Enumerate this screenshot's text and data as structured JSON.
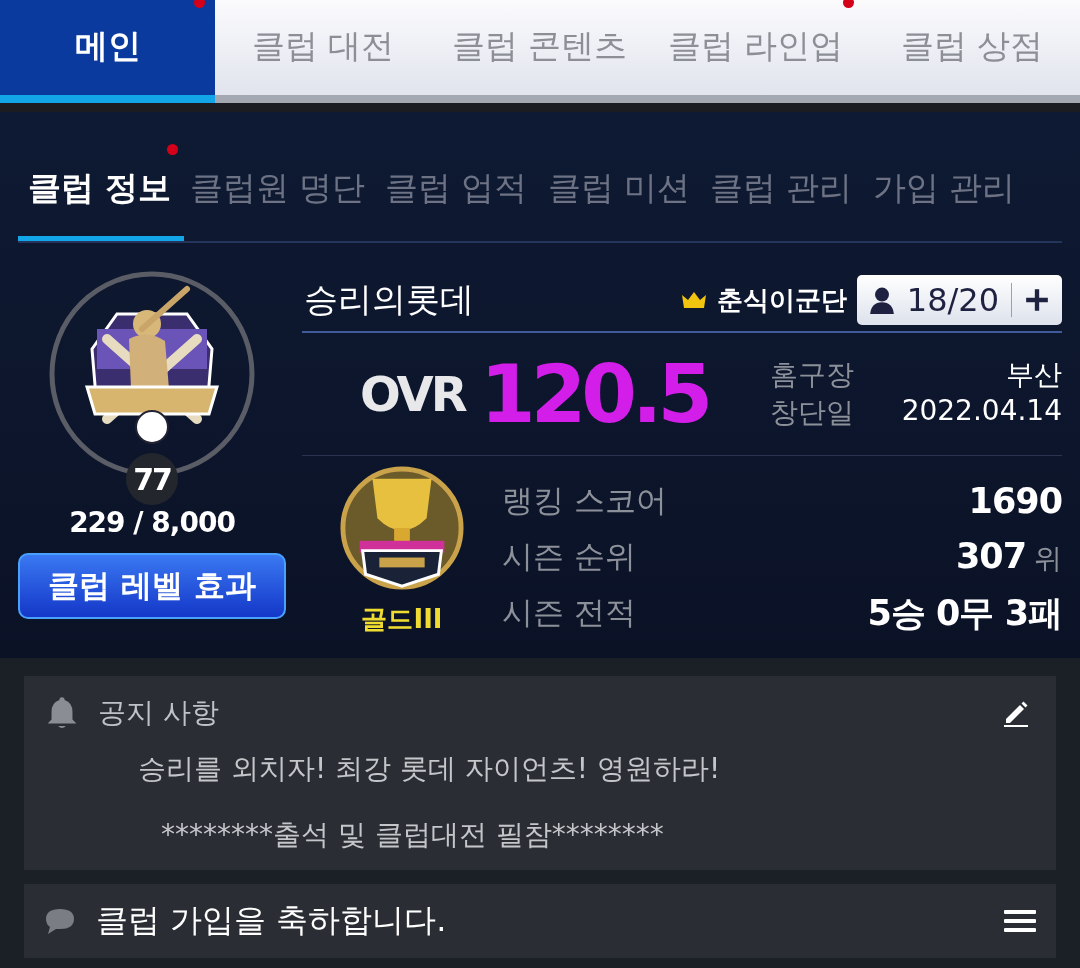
{
  "top_tabs": [
    {
      "label": "메인",
      "selected": true,
      "dot": true
    },
    {
      "label": "클럽 대전",
      "selected": false,
      "dot": false
    },
    {
      "label": "클럽 콘텐츠",
      "selected": false,
      "dot": false
    },
    {
      "label": "클럽 라인업",
      "selected": false,
      "dot": true
    },
    {
      "label": "클럽 상점",
      "selected": false,
      "dot": false
    }
  ],
  "sub_tabs": [
    {
      "label": "클럽 정보",
      "selected": true,
      "dot": true
    },
    {
      "label": "클럽원 명단",
      "selected": false,
      "dot": false
    },
    {
      "label": "클럽 업적",
      "selected": false,
      "dot": false
    },
    {
      "label": "클럽 미션",
      "selected": false,
      "dot": false
    },
    {
      "label": "클럽 관리",
      "selected": false,
      "dot": false
    },
    {
      "label": "가입 관리",
      "selected": false,
      "dot": false
    }
  ],
  "club": {
    "level": "77",
    "exp": "229 / 8,000",
    "level_button": "클럽 레벨 효과",
    "name": "승리의롯데",
    "leader": "춘식이군단",
    "members": "18/20",
    "ovr_label": "OVR",
    "ovr": "120.5",
    "info": [
      {
        "label": "홈구장",
        "value": "부산"
      },
      {
        "label": "창단일",
        "value": "2022.04.14"
      }
    ],
    "tier": "골드III",
    "stats": [
      {
        "label": "랭킹 스코어",
        "value": "1690"
      },
      {
        "label": "시즌 순위",
        "value": "307",
        "unit": "위"
      },
      {
        "label": "시즌 전적",
        "value": "5승 0무 3패"
      }
    ]
  },
  "notice": {
    "title": "공지 사항",
    "lines": [
      "승리를 외치자! 최강 롯데 자이언츠! 영원하라!",
      "********출석 및 클럽대전 필참********"
    ]
  },
  "chat": {
    "message": "클럽 가입을 축하합니다."
  }
}
